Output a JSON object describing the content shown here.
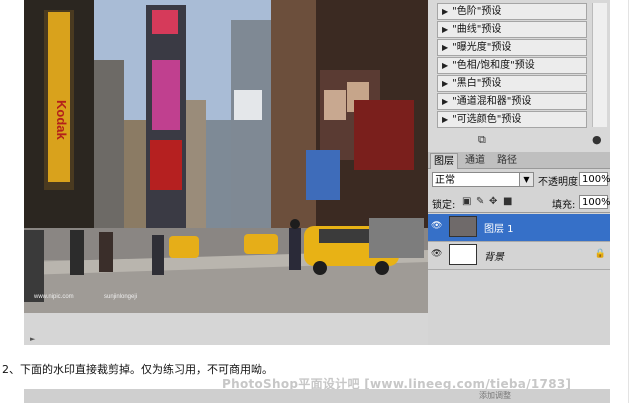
{
  "adjustments": {
    "items": [
      "\"色阶\"预设",
      "\"曲线\"预设",
      "\"曝光度\"预设",
      "\"色相/饱和度\"预设",
      "\"黑白\"预设",
      "\"通道混和器\"预设",
      "\"可选颜色\"预设"
    ],
    "item_arrow_icon": "triangle-right-icon"
  },
  "layers": {
    "tabs": [
      "图层",
      "通道",
      "路径"
    ],
    "blend_mode": "正常",
    "opacity_label": "不透明度:",
    "opacity_value": "100%",
    "lock_label": "锁定:",
    "fill_label": "填充:",
    "fill_value": "100%",
    "rows": [
      {
        "name": "图层 1",
        "selected": true
      },
      {
        "name": "背景",
        "selected": false
      }
    ],
    "selection_color": "#3670c8"
  },
  "photo": {
    "brand_sign": "Kodak",
    "watermark_left": "www.nipic.com",
    "watermark_right": "sunjinlongeji"
  },
  "caption": "2、下面的水印直接裁剪掉。仅为练习用，不可商用呦。",
  "watermark": "PhotoShop平面设计吧 [www.lineeg.com/tieba/1783]",
  "bottom_strip_text": "添加调整"
}
